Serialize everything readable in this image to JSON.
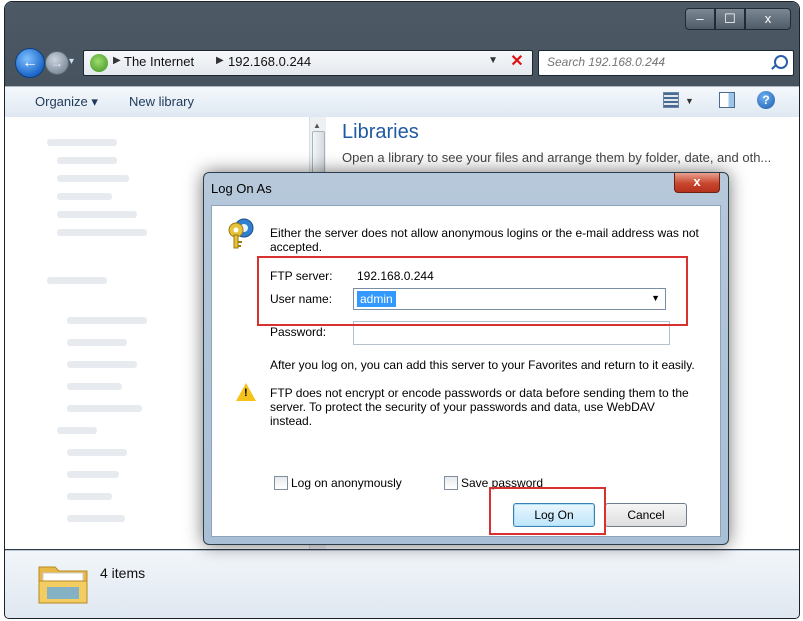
{
  "window": {
    "caption_buttons": [
      "–",
      "☐",
      "x"
    ]
  },
  "address_bar": {
    "segments": [
      "The Internet",
      "192.168.0.244"
    ]
  },
  "search": {
    "placeholder": "Search 192.168.0.244"
  },
  "toolbar": {
    "organize_label": "Organize ▾",
    "new_library_label": "New library",
    "help_label": "?"
  },
  "content": {
    "title": "Libraries",
    "subtitle": "Open a library to see your files and arrange them by folder, date, and oth..."
  },
  "status": {
    "item_count": "4 items"
  },
  "dialog": {
    "title": "Log On As",
    "close_label": "x",
    "message": "Either the server does not allow anonymous logins or the e-mail address was not accepted.",
    "ftp_server_label": "FTP server:",
    "ftp_server_value": "192.168.0.244",
    "user_name_label": "User name:",
    "user_name_value": "admin",
    "password_label": "Password:",
    "info_text": "After you log on, you can add this server to your Favorites and return to it easily.",
    "warning_text": "FTP does not encrypt or encode passwords or data before sending them to the server.  To protect the security of your passwords and data, use WebDAV instead.",
    "anonymous_label": "Log on anonymously",
    "save_password_label": "Save password",
    "logon_label": "Log On",
    "cancel_label": "Cancel"
  },
  "colors": {
    "highlight": "#d93030",
    "selection": "#3399ff",
    "libraries_title": "#1e5aa3"
  }
}
